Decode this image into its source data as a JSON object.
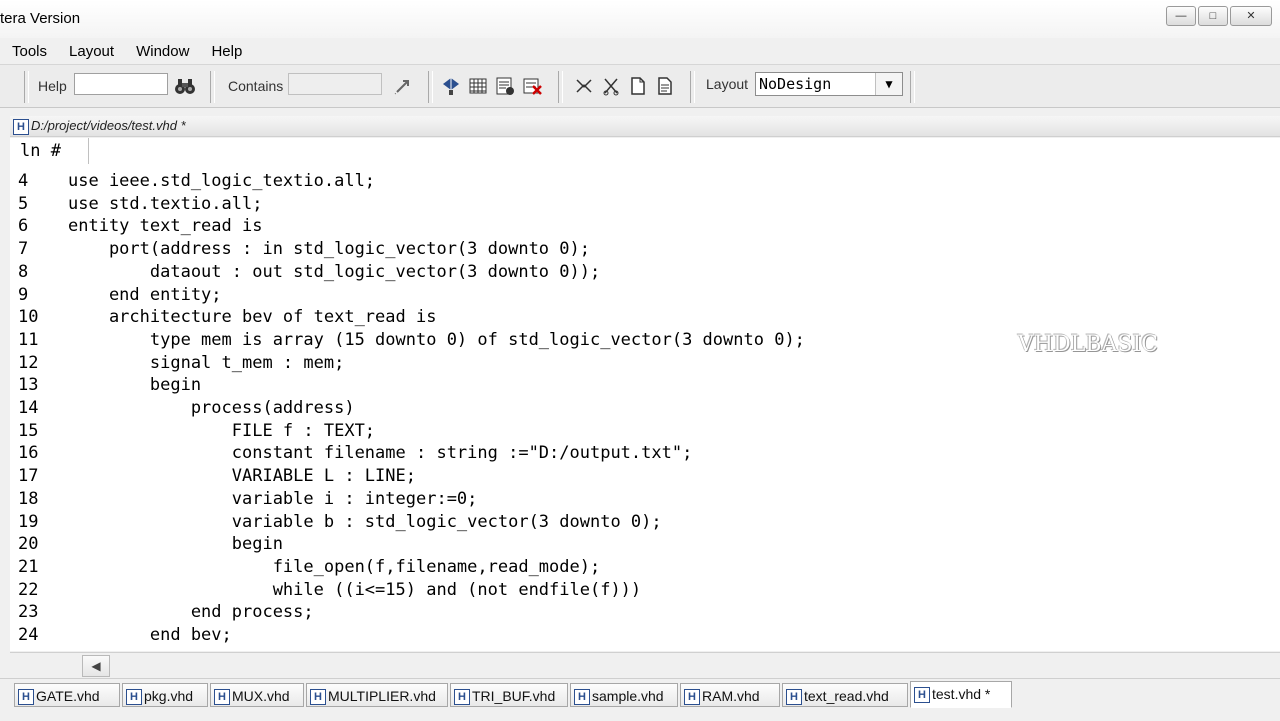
{
  "window": {
    "title": "tera Version"
  },
  "menu": [
    "Tools",
    "Layout",
    "Window",
    "Help"
  ],
  "toolbar": {
    "help_label": "Help",
    "help_value": "",
    "contains_label": "Contains",
    "contains_value": "",
    "layout_label": "Layout",
    "layout_value": "NoDesign"
  },
  "document": {
    "path": "D:/project/videos/test.vhd *"
  },
  "editor": {
    "ln_header": "ln #",
    "lines": [
      {
        "num": "4",
        "text": "use ieee.std_logic_textio.all;"
      },
      {
        "num": "5",
        "text": "use std.textio.all;"
      },
      {
        "num": "6",
        "text": "entity text_read is"
      },
      {
        "num": "7",
        "text": "    port(address : in std_logic_vector(3 downto 0);"
      },
      {
        "num": "8",
        "text": "        dataout : out std_logic_vector(3 downto 0));"
      },
      {
        "num": "9",
        "text": "    end entity;"
      },
      {
        "num": "10",
        "text": "    architecture bev of text_read is"
      },
      {
        "num": "11",
        "text": "        type mem is array (15 downto 0) of std_logic_vector(3 downto 0);"
      },
      {
        "num": "12",
        "text": "        signal t_mem : mem;"
      },
      {
        "num": "13",
        "text": "        begin"
      },
      {
        "num": "14",
        "text": "            process(address)"
      },
      {
        "num": "15",
        "text": "                FILE f : TEXT;"
      },
      {
        "num": "16",
        "text": "                constant filename : string :=\"D:/output.txt\";"
      },
      {
        "num": "17",
        "text": "                VARIABLE L : LINE;"
      },
      {
        "num": "18",
        "text": "                variable i : integer:=0;"
      },
      {
        "num": "19",
        "text": "                variable b : std_logic_vector(3 downto 0);"
      },
      {
        "num": "20",
        "text": "                begin"
      },
      {
        "num": "21",
        "text": "                    file_open(f,filename,read_mode);"
      },
      {
        "num": "22",
        "text": "                    while ((i<=15) and (not endfile(f)))"
      },
      {
        "num": "23",
        "text": "            end process;"
      },
      {
        "num": "24",
        "text": "        end bev;"
      }
    ]
  },
  "watermark": "VHDLBASIC",
  "tabs": [
    {
      "label": "GATE.vhd",
      "active": false
    },
    {
      "label": "pkg.vhd",
      "active": false
    },
    {
      "label": "MUX.vhd",
      "active": false
    },
    {
      "label": "MULTIPLIER.vhd",
      "active": false
    },
    {
      "label": "TRI_BUF.vhd",
      "active": false
    },
    {
      "label": "sample.vhd",
      "active": false
    },
    {
      "label": "RAM.vhd",
      "active": false
    },
    {
      "label": "text_read.vhd",
      "active": false
    },
    {
      "label": "test.vhd *",
      "active": true
    }
  ],
  "icons": [
    "minimize-icon",
    "maximize-icon",
    "close-icon",
    "binoculars-icon",
    "find-next-icon",
    "compile-icon",
    "grid-icon",
    "simulate-icon",
    "cut-icon",
    "cancel-icon",
    "file-icon",
    "save-icon",
    "dropdown-arrow-icon",
    "scroll-left-icon",
    "hdl-file-icon"
  ],
  "colors": {
    "keyword": "#b22a1e",
    "type": "#2a47a0",
    "number": "#8a1f12",
    "signal": "#c41fb8",
    "variable": "#c5a800"
  }
}
